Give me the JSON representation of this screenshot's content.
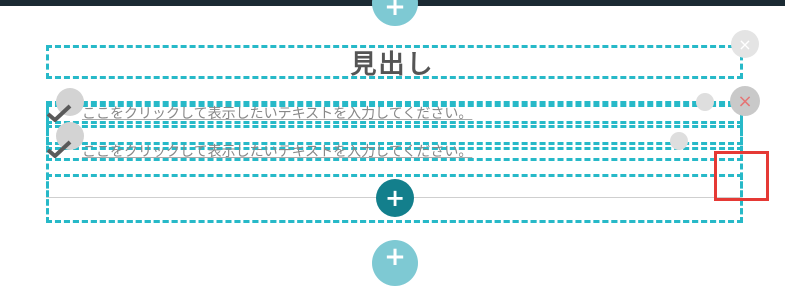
{
  "heading": {
    "text": "見出し"
  },
  "list": {
    "items": [
      {
        "text": "ここをクリックして表示したいテキストを入力してください。"
      },
      {
        "text": "ここをクリックして表示したいテキストを入力してください。"
      }
    ]
  },
  "buttons": {
    "add_symbol": "+",
    "close_symbol": "×"
  },
  "colors": {
    "accent": "#27b9c8",
    "add_dark": "#137f8c",
    "add_light": "#7ec9d3",
    "highlight": "#e53935"
  }
}
